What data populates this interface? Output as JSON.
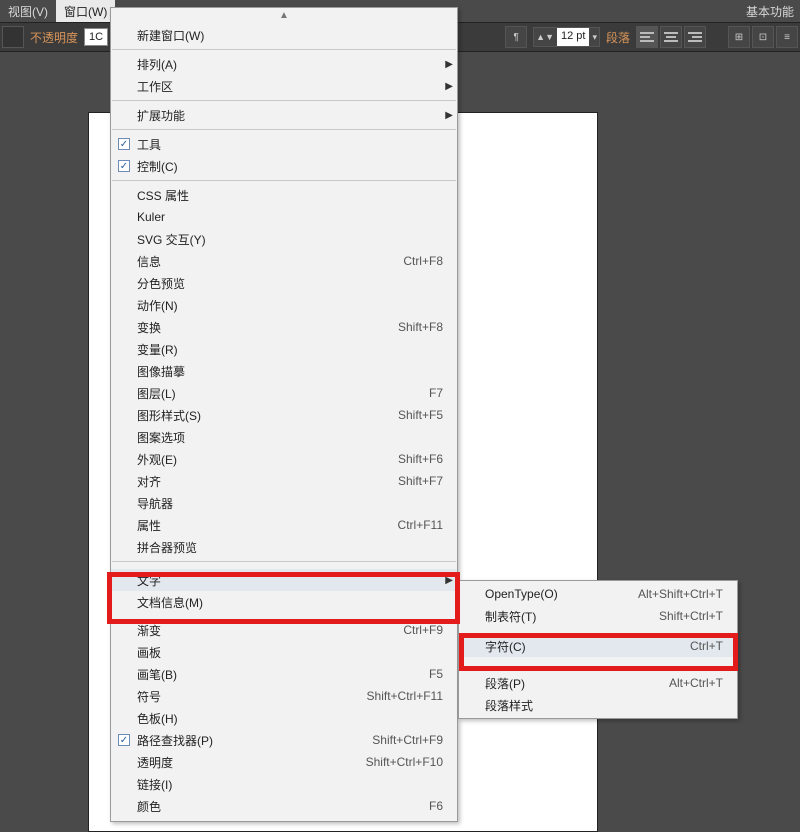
{
  "menubar": {
    "view": "视图(V)",
    "window": "窗口(W)",
    "right": "基本功能"
  },
  "toolbar": {
    "opacity_label": "不透明度",
    "opacity_value": "1C",
    "font_size": "12 pt",
    "paragraph_label": "段落"
  },
  "annotation": "窗口",
  "menu_main": {
    "new_window": "新建窗口(W)",
    "arrange": "排列(A)",
    "workspace": "工作区",
    "extensions": "扩展功能",
    "tools": "工具",
    "control": "控制(C)",
    "css": "CSS 属性",
    "kuler": "Kuler",
    "svg": "SVG 交互(Y)",
    "info": {
      "label": "信息",
      "sc": "Ctrl+F8"
    },
    "sep_preview": "分色预览",
    "actions": "动作(N)",
    "transform": {
      "label": "变换",
      "sc": "Shift+F8"
    },
    "variables": "变量(R)",
    "image_trace": "图像描摹",
    "layers": {
      "label": "图层(L)",
      "sc": "F7"
    },
    "graphic_styles": {
      "label": "图形样式(S)",
      "sc": "Shift+F5"
    },
    "pattern_options": "图案选项",
    "appearance": {
      "label": "外观(E)",
      "sc": "Shift+F6"
    },
    "align": {
      "label": "对齐",
      "sc": "Shift+F7"
    },
    "navigator": "导航器",
    "attributes": {
      "label": "属性",
      "sc": "Ctrl+F11"
    },
    "flattener": "拼合器预览",
    "type": "文字",
    "doc_info": "文档信息(M)",
    "gradient": {
      "label": "渐变",
      "sc": "Ctrl+F9"
    },
    "artboards": "画板",
    "brushes": {
      "label": "画笔(B)",
      "sc": "F5"
    },
    "symbols": {
      "label": "符号",
      "sc": "Shift+Ctrl+F11"
    },
    "swatches": "色板(H)",
    "pathfinder": {
      "label": "路径查找器(P)",
      "sc": "Shift+Ctrl+F9"
    },
    "transparency": {
      "label": "透明度",
      "sc": "Shift+Ctrl+F10"
    },
    "links": "链接(I)",
    "color": {
      "label": "颜色",
      "sc": "F6"
    }
  },
  "submenu": {
    "opentype": {
      "label": "OpenType(O)",
      "sc": "Alt+Shift+Ctrl+T"
    },
    "tabs": {
      "label": "制表符(T)",
      "sc": "Shift+Ctrl+T"
    },
    "character": {
      "label": "字符(C)",
      "sc": "Ctrl+T"
    },
    "paragraph": {
      "label": "段落(P)",
      "sc": "Alt+Ctrl+T"
    },
    "para_styles": "段落样式"
  }
}
